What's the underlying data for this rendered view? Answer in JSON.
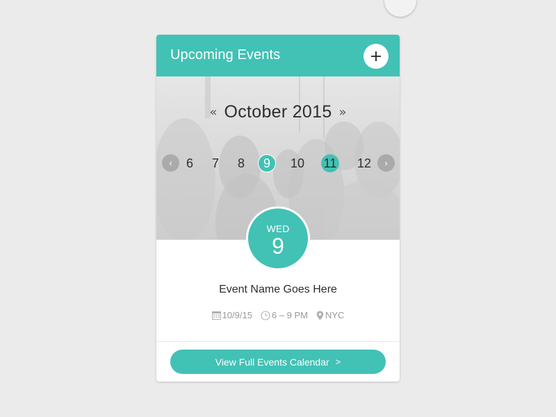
{
  "colors": {
    "accent": "#42c1b5",
    "page_background": "#ebebeb",
    "text_dark": "#2e2e2e",
    "text_muted": "#9a9a9a"
  },
  "header": {
    "title": "Upcoming Events",
    "add_button_icon": "plus-icon"
  },
  "calendar": {
    "month_label": "October 2015",
    "prev_month_glyph": "«",
    "next_month_glyph": "»",
    "prev_days_glyph": "‹",
    "next_days_glyph": "›",
    "days": [
      {
        "label": "6",
        "state": "normal"
      },
      {
        "label": "7",
        "state": "normal"
      },
      {
        "label": "8",
        "state": "normal"
      },
      {
        "label": "9",
        "state": "selected"
      },
      {
        "label": "10",
        "state": "normal"
      },
      {
        "label": "11",
        "state": "has-event"
      },
      {
        "label": "12",
        "state": "normal"
      }
    ]
  },
  "selected_date": {
    "weekday": "WED",
    "day": "9"
  },
  "event": {
    "name": "Event Name Goes Here",
    "date": "10/9/15",
    "time": "6 – 9 PM",
    "location": "NYC"
  },
  "cta": {
    "label": "View Full Events Calendar",
    "chevron": ">"
  }
}
